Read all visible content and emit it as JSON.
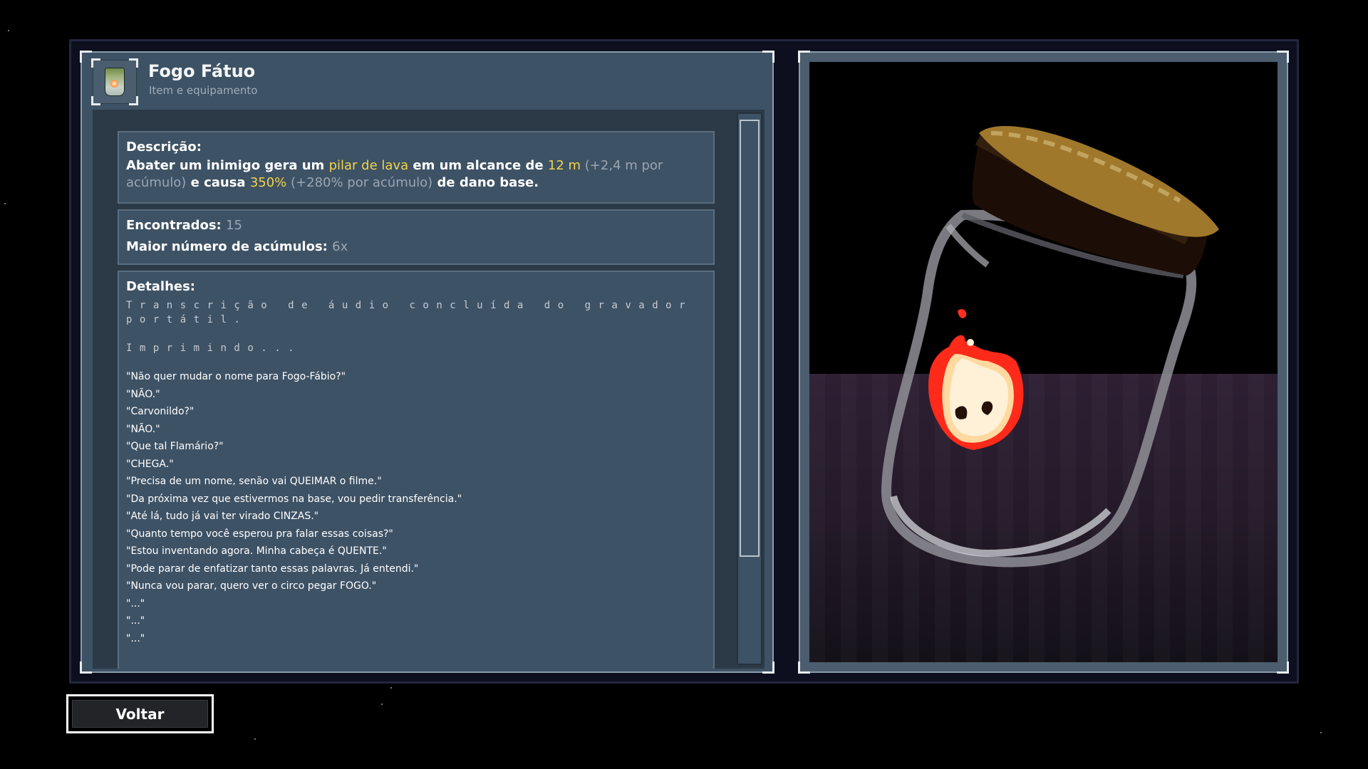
{
  "item": {
    "title": "Fogo Fátuo",
    "subtitle": "Item e equipamento",
    "icon": "jar-icon"
  },
  "description": {
    "heading": "Descrição:",
    "parts": [
      {
        "t": "Abater um inimigo gera um ",
        "s": "n"
      },
      {
        "t": "pilar de lava",
        "s": "y"
      },
      {
        "t": " em um alcance de ",
        "s": "n"
      },
      {
        "t": "12 m",
        "s": "y"
      },
      {
        "t": " (+2,4 m por acúmulo)",
        "s": "g"
      },
      {
        "t": " e causa ",
        "s": "n"
      },
      {
        "t": "350%",
        "s": "y"
      },
      {
        "t": " (+280% por acúmulo)",
        "s": "g"
      },
      {
        "t": " de dano base.",
        "s": "n"
      }
    ]
  },
  "stats": {
    "found_label": "Encontrados:",
    "found_value": "15",
    "max_stacks_label": "Maior número de acúmulos:",
    "max_stacks_value": "6x"
  },
  "details": {
    "heading": "Detalhes:",
    "line1": "Transcrição de áudio concluída do gravador portátil.",
    "line2": "Imprimindo...",
    "quotes": [
      "\"Não quer mudar o nome para Fogo-Fábio?\"",
      "\"NÃO.\"",
      "\"Carvonildo?\"",
      "\"NÃO.\"",
      "\"Que tal Flamário?\"",
      "\"CHEGA.\"",
      "\"Precisa de um nome, senão vai QUEIMAR o filme.\"",
      "\"Da próxima vez que estivermos na base, vou pedir transferência.\"",
      "\"Até lá, tudo já vai ter virado CINZAS.\"",
      "\"Quanto tempo você esperou pra falar essas coisas?\"",
      "\"Estou inventando agora. Minha cabeça é QUENTE.\"",
      "\"Pode parar de enfatizar tanto essas palavras. Já entendi.\"",
      "\"Nunca vou parar, quero ver o circo pegar FOGO.\"",
      "\"...\"",
      "\"...\"",
      "\"...\""
    ]
  },
  "buttons": {
    "back_label": "Voltar"
  },
  "colors": {
    "highlight": "#f2d34b",
    "muted": "#9aa6b2",
    "panel": "#3e5265"
  }
}
